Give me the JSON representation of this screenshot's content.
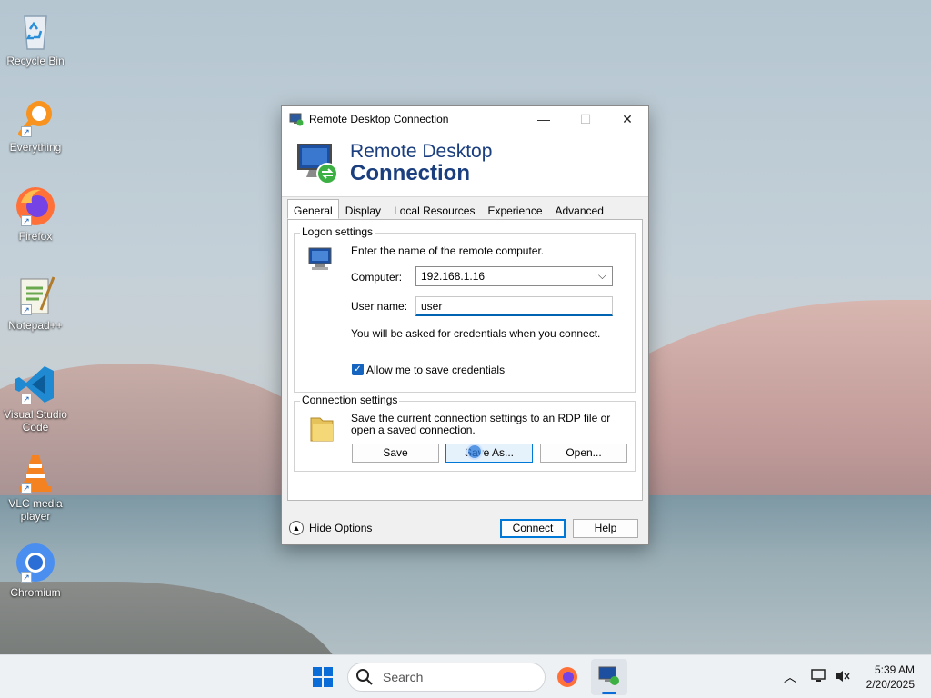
{
  "desktop": {
    "icons": [
      {
        "label": "Recycle Bin"
      },
      {
        "label": "Everything"
      },
      {
        "label": "Firefox"
      },
      {
        "label": "Notepad++"
      },
      {
        "label": "Visual Studio Code"
      },
      {
        "label": "VLC media player"
      },
      {
        "label": "Chromium"
      }
    ]
  },
  "window": {
    "title": "Remote Desktop Connection",
    "minimize": "—",
    "maximize": "☐",
    "close": "✕",
    "banner_line1": "Remote Desktop",
    "banner_line2": "Connection"
  },
  "tabs": [
    {
      "label": "General",
      "active": true
    },
    {
      "label": "Display"
    },
    {
      "label": "Local Resources"
    },
    {
      "label": "Experience"
    },
    {
      "label": "Advanced"
    }
  ],
  "logon": {
    "group_title": "Logon settings",
    "instruction": "Enter the name of the remote computer.",
    "computer_label": "Computer:",
    "computer_value": "192.168.1.16",
    "username_label": "User name:",
    "username_value": "user",
    "credentials_note": "You will be asked for credentials when you connect.",
    "save_credentials_label": "Allow me to save credentials",
    "save_credentials_checked": true
  },
  "connection": {
    "group_title": "Connection settings",
    "description": "Save the current connection settings to an RDP file or open a saved connection.",
    "save_label": "Save",
    "save_as_label": "Save As...",
    "open_label": "Open..."
  },
  "footer": {
    "hide_options_label": "Hide Options",
    "connect_label": "Connect",
    "help_label": "Help"
  },
  "taskbar": {
    "search_placeholder": "Search",
    "time": "5:39 AM",
    "date": "2/20/2025"
  },
  "colors": {
    "accent": "#0078d7",
    "banner_text": "#1a3e7e",
    "checkbox": "#1565c0"
  }
}
